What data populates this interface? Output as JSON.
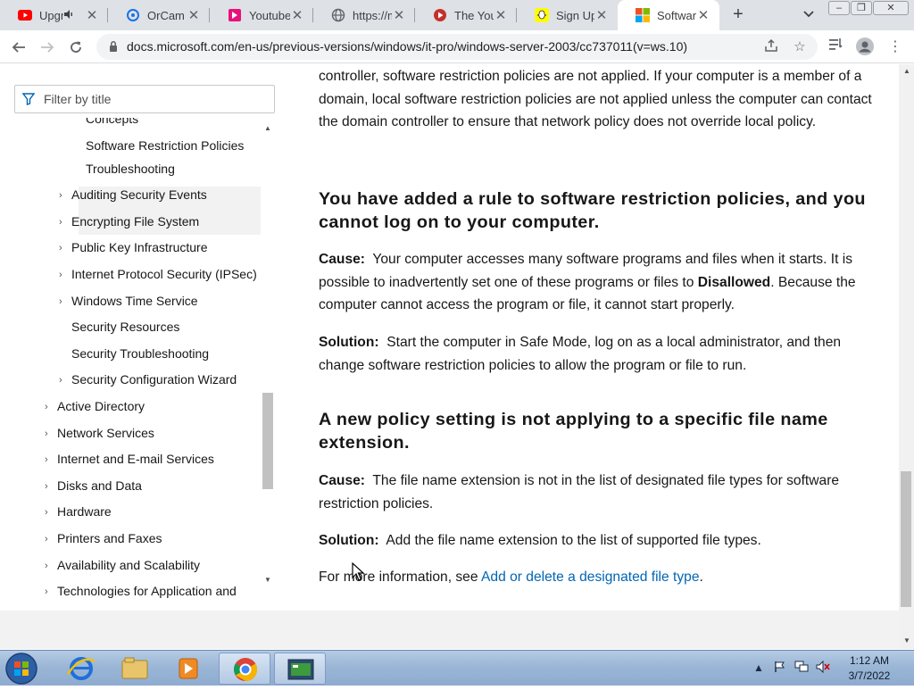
{
  "browser": {
    "tabs": [
      {
        "title": "Upgr",
        "icon": "youtube-icon"
      },
      {
        "title": "OrCam R",
        "icon": "orcam-icon"
      },
      {
        "title": "Youtube",
        "icon": "pink-bookmark-icon"
      },
      {
        "title": "https://m",
        "icon": "globe-icon"
      },
      {
        "title": "The YouT",
        "icon": "youtube-red-icon"
      },
      {
        "title": "Sign Up",
        "icon": "snapchat-icon"
      },
      {
        "title": "Software",
        "icon": "microsoft-icon"
      }
    ],
    "url": "docs.microsoft.com/en-us/previous-versions/windows/it-pro/windows-server-2003/cc737011(v=ws.10)",
    "colors": {
      "accent": "#0065b3",
      "tab_strip": "#dee1e6"
    }
  },
  "sidebar": {
    "filter_placeholder": "Filter by title",
    "items": [
      {
        "label": "Concepts",
        "expandable": false
      },
      {
        "label": "Software Restriction Policies",
        "expandable": false
      },
      {
        "label": "Troubleshooting",
        "expandable": false
      },
      {
        "label": "Auditing Security Events",
        "expandable": true
      },
      {
        "label": "Encrypting File System",
        "expandable": true
      },
      {
        "label": "Public Key Infrastructure",
        "expandable": true
      },
      {
        "label": "Internet Protocol Security (IPSec)",
        "expandable": true
      },
      {
        "label": "Windows Time Service",
        "expandable": true
      },
      {
        "label": "Security Resources",
        "expandable": false
      },
      {
        "label": "Security Troubleshooting",
        "expandable": false
      },
      {
        "label": "Security Configuration Wizard",
        "expandable": true
      },
      {
        "label": "Active Directory",
        "expandable": true
      },
      {
        "label": "Network Services",
        "expandable": true
      },
      {
        "label": "Internet and E-mail Services",
        "expandable": true
      },
      {
        "label": "Disks and Data",
        "expandable": true
      },
      {
        "label": "Hardware",
        "expandable": true
      },
      {
        "label": "Printers and Faxes",
        "expandable": true
      },
      {
        "label": "Availability and Scalability",
        "expandable": true
      },
      {
        "label": "Technologies for Application and",
        "expandable": true
      }
    ]
  },
  "article": {
    "intro": "controller, software restriction policies are not applied. If your computer is a member of a domain, local software restriction policies are not applied unless the computer can contact the domain controller to ensure that network policy does not override local policy.",
    "section1": {
      "heading": "You have added a rule to software restriction policies, and you cannot log on to your computer.",
      "cause_label": "Cause:",
      "cause_before": "Your computer accesses many software programs and files when it starts. It is possible to inadvertently set one of these programs or files to",
      "cause_bold": "Disallowed",
      "cause_after": ". Because the computer cannot access the program or file, it cannot start properly.",
      "solution_label": "Solution:",
      "solution": "Start the computer in Safe Mode, log on as a local administrator, and then change software restriction policies to allow the program or file to run."
    },
    "section2": {
      "heading": "A new policy setting is not applying to a specific file name extension.",
      "cause_label": "Cause:",
      "cause": "The file name extension is not in the list of designated file types for software restriction policies.",
      "solution_label": "Solution:",
      "solution": "Add the file name extension to the list of supported file types."
    },
    "more_info_prefix": "For more information, see",
    "more_info_link": "Add or delete a designated file type",
    "more_info_suffix": "."
  },
  "taskbar": {
    "time": "1:12 AM",
    "date": "3/7/2022"
  }
}
